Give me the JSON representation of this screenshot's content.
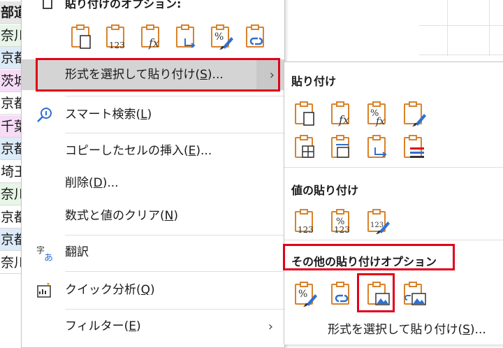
{
  "sheet_cells": [
    {
      "text": "部道",
      "bg": "#e6e6e6",
      "bold": true
    },
    {
      "text": "奈川",
      "bg": "#e8f6e8"
    },
    {
      "text": "京都",
      "bg": "#ddeaf8"
    },
    {
      "text": "茨城",
      "bg": "#f6dcf6"
    },
    {
      "text": "京都",
      "bg": "#ffffff"
    },
    {
      "text": "千葉",
      "bg": "#f6dcf6"
    },
    {
      "text": "京都",
      "bg": "#ddeaf8"
    },
    {
      "text": "埼玉",
      "bg": "#ffffff"
    },
    {
      "text": "奈川",
      "bg": "#e8f6e8"
    },
    {
      "text": "京都",
      "bg": "#ffffff"
    },
    {
      "text": "京都",
      "bg": "#ddeaf8"
    },
    {
      "text": "奈川",
      "bg": "#ffffff"
    }
  ],
  "menu": {
    "paste_options_header": "貼り付けのオプション:",
    "paste_special": "形式を選択して貼り付け(",
    "paste_special_key": "S",
    "paste_special_tail": ")...",
    "smart_lookup": "スマート検索(",
    "smart_lookup_key": "L",
    "smart_lookup_tail": ")",
    "insert_copied": "コピーしたセルの挿入(",
    "insert_copied_key": "E",
    "insert_copied_tail": ")...",
    "delete": "削除(",
    "delete_key": "D",
    "delete_tail": ")...",
    "clear": "数式と値のクリア(",
    "clear_key": "N",
    "clear_tail": ")",
    "translate": "翻訳",
    "quick_analysis": "クイック分析(",
    "quick_analysis_key": "Q",
    "quick_analysis_tail": ")",
    "filter": "フィルター(",
    "filter_key": "E",
    "filter_tail": ")"
  },
  "submenu": {
    "paste_title": "貼り付け",
    "values_title": "値の貼り付け",
    "other_title": "その他の貼り付けオプション",
    "bottom": "形式を選択して貼り付け(",
    "bottom_key": "S",
    "bottom_tail": ")..."
  },
  "icon_labels": {
    "values": "123",
    "formula": "fx",
    "percent": "%"
  },
  "colors": {
    "clipboard": "#d9822b",
    "accent_blue": "#2f6fd0",
    "highlight_red": "#e0001a"
  }
}
